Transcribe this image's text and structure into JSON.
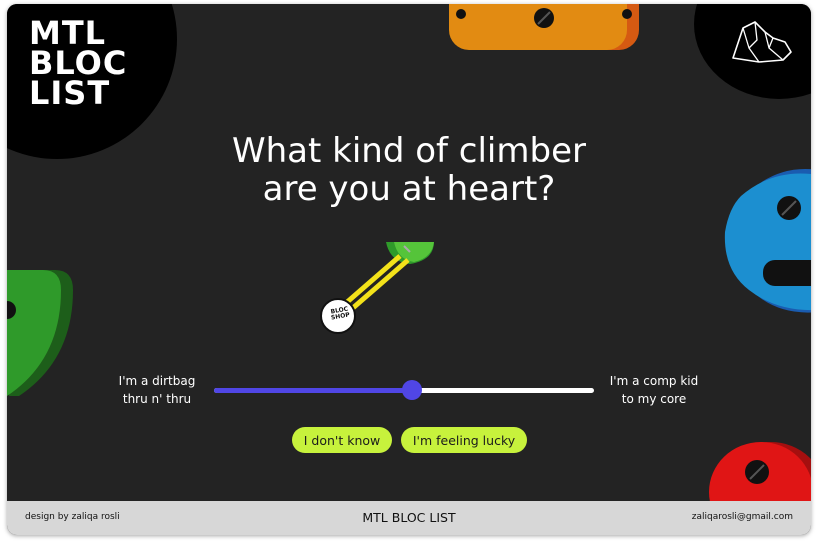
{
  "brand": {
    "logo_lines": [
      "MTL",
      "BLOC",
      "LIST"
    ]
  },
  "quiz": {
    "heading_line1": "What kind of climber",
    "heading_line2": "are you at heart?",
    "slider": {
      "left_label_line1": "I'm a dirtbag",
      "left_label_line2": "thru n' thru",
      "right_label_line1": "I'm a comp kid",
      "right_label_line2": "to my core",
      "value_percent": 52
    },
    "buttons": {
      "dont_know": "I don't know",
      "feeling_lucky": "I'm feeling lucky"
    },
    "badge_text": "BLOC SHOP"
  },
  "footer": {
    "credit": "design by zaliqa rosli",
    "title": "MTL BLOC LIST",
    "email": "zaliqarosli@gmail.com"
  },
  "colors": {
    "background": "#232323",
    "accent_purple": "#5046e5",
    "button_lime": "#c7f23c",
    "hold_orange": "#e28b12",
    "hold_blue": "#1c8fd0",
    "hold_green": "#2f9a2a",
    "hold_red": "#e01515",
    "footer_bg": "#d7d7d7"
  },
  "icons": [
    "mountain-icon",
    "climbing-hold-icons",
    "quickdraw-icon"
  ]
}
